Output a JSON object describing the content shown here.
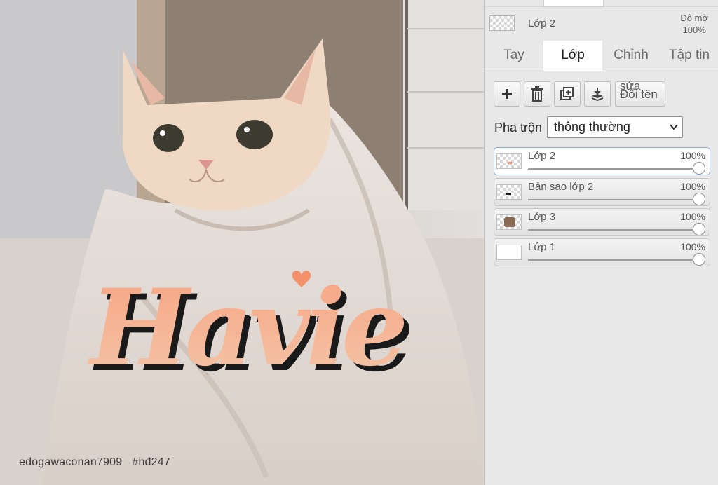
{
  "canvas": {
    "watermark_user": "edogawaconan7909",
    "watermark_tag": "#hđ247"
  },
  "panel": {
    "current_layer": {
      "name": "Lớp 2",
      "opacity_label": "Độ mờ",
      "opacity_value": "100%"
    },
    "tabs": [
      {
        "label": "Tay",
        "active": false
      },
      {
        "label": "Lớp",
        "active": true
      },
      {
        "label": "Chỉnh sửa",
        "active": false
      },
      {
        "label": "Tập tin",
        "active": false
      }
    ],
    "toolbar": {
      "add_icon": "plus-icon",
      "delete_icon": "trash-icon",
      "duplicate_icon": "duplicate-icon",
      "merge_icon": "merge-down-icon",
      "rename_line1": "sửa",
      "rename_line2": "Đổi tên"
    },
    "blend": {
      "label": "Pha trộn",
      "value": "thông thường"
    },
    "layers": [
      {
        "name": "Lớp 2",
        "opacity": "100%",
        "opacity_fraction": 1.0,
        "selected": true
      },
      {
        "name": "Bản sao lớp 2",
        "opacity": "100%",
        "opacity_fraction": 1.0,
        "selected": false
      },
      {
        "name": "Lớp 3",
        "opacity": "100%",
        "opacity_fraction": 1.0,
        "selected": false
      },
      {
        "name": "Lớp 1",
        "opacity": "100%",
        "opacity_fraction": 1.0,
        "selected": false
      }
    ]
  },
  "colors": {
    "accent_orange": "#f2916a",
    "selected_border": "#8ea8d8",
    "panel_bg": "#e8e8e8"
  }
}
